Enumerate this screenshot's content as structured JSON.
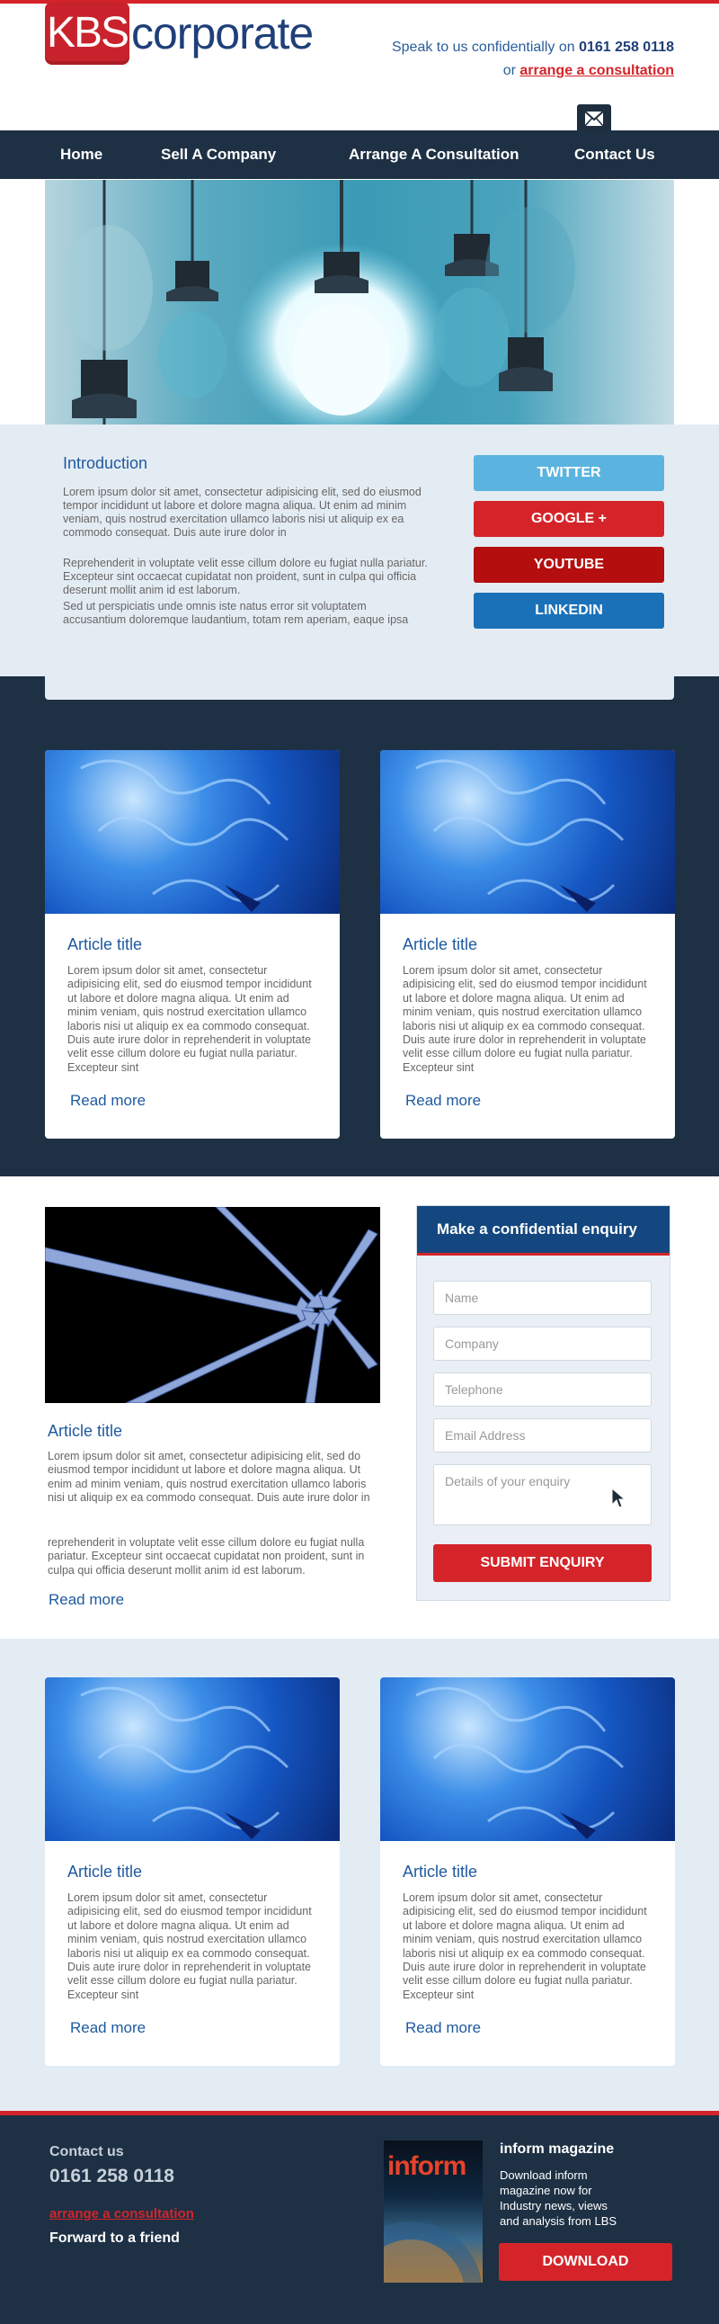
{
  "header": {
    "logo_letters": "KBS",
    "logo_word": "corporate",
    "speak_text": "Speak to us confidentially on",
    "phone": "0161 258 0118",
    "or_text": "or",
    "consult_link": "arrange a consultation"
  },
  "nav": {
    "items": [
      "Home",
      "Sell A Company",
      "Arrange A Consultation",
      "Contact Us"
    ]
  },
  "intro": {
    "title": "Introduction",
    "para1": "Lorem ipsum dolor sit amet, consectetur adipisicing elit, sed do eiusmod tempor incididunt ut labore et dolore magna aliqua. Ut enim ad minim veniam, quis nostrud exercitation ullamco laboris nisi ut aliquip ex ea commodo consequat. Duis aute irure dolor in",
    "para2": "Reprehenderit in voluptate velit esse cillum dolore eu fugiat nulla pariatur. Excepteur sint occaecat cupidatat non proident, sunt in culpa qui officia deserunt mollit anim id est laborum.",
    "para3": "Sed ut perspiciatis unde omnis iste natus error sit voluptatem accusantium doloremque laudantium, totam rem aperiam, eaque ipsa"
  },
  "social": {
    "twitter": "TWITTER",
    "google": "GOOGLE +",
    "youtube": "YOUTUBE",
    "linkedin": "LINKEDIN",
    "colors": {
      "twitter": "#5bb4e0",
      "google": "#d4242a",
      "youtube": "#b40e0e",
      "linkedin": "#1a71b8"
    }
  },
  "articles": {
    "card_title": "Article title",
    "card_text": "Lorem ipsum dolor sit amet, consectetur adipisicing elit, sed do eiusmod tempor incididunt ut labore et dolore magna aliqua. Ut enim ad minim veniam, quis nostrud exercitation ullamco laboris nisi ut aliquip ex ea commodo consequat. Duis aute irure dolor in reprehenderit in voluptate velit esse cillum dolore eu fugiat nulla pariatur. Excepteur sint",
    "read_more": "Read more"
  },
  "feature": {
    "title": "Article title",
    "para1": "Lorem ipsum dolor sit amet, consectetur adipisicing elit, sed do eiusmod tempor incididunt ut labore et dolore magna aliqua. Ut enim ad minim veniam, quis nostrud exercitation ullamco laboris nisi ut aliquip ex ea commodo consequat. Duis aute irure dolor in",
    "para2": "reprehenderit in voluptate velit esse cillum dolore eu fugiat nulla pariatur. Excepteur sint occaecat cupidatat non proident, sunt in culpa qui officia deserunt mollit anim id est laborum.",
    "read_more": "Read more"
  },
  "enquiry": {
    "title": "Make a confidential enquiry",
    "name_placeholder": "Name",
    "company_placeholder": "Company",
    "telephone_placeholder": "Telephone",
    "email_placeholder": "Email Address",
    "details_placeholder": "Details of your enquiry",
    "submit": "SUBMIT ENQUIRY"
  },
  "footer": {
    "contact_us": "Contact us",
    "phone": "0161 258 0118",
    "arrange": "arrange a consultation",
    "forward": "Forward to a friend",
    "mag_cover_title": "inform",
    "mag_title": "inform magazine",
    "mag_desc": "Download inform magazine now for Industry news, views and analysis from LBS",
    "download": "DOWNLOAD"
  },
  "icons": [
    "mail-icon",
    "cursor-icon"
  ]
}
